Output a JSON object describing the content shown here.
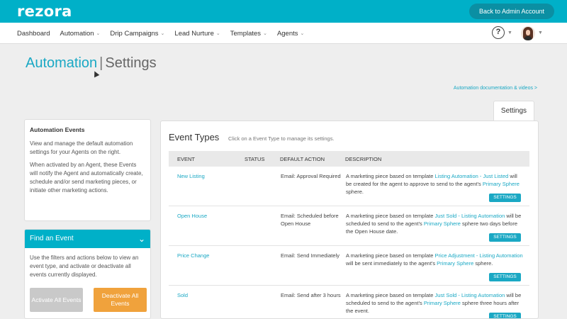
{
  "header": {
    "logo": "rezora",
    "back_button": "Back to Admin Account"
  },
  "nav": {
    "items": [
      {
        "label": "Dashboard",
        "dropdown": false
      },
      {
        "label": "Automation",
        "dropdown": true
      },
      {
        "label": "Drip Campaigns",
        "dropdown": true
      },
      {
        "label": "Lead Nurture",
        "dropdown": true
      },
      {
        "label": "Templates",
        "dropdown": true
      },
      {
        "label": "Agents",
        "dropdown": true
      }
    ],
    "help_icon": "?"
  },
  "page": {
    "title_main": "Automation",
    "title_sep": "|",
    "title_sub": "Settings",
    "doc_link": "Automation documentation & videos >",
    "tab_label": "Settings"
  },
  "info_card": {
    "title": "Automation Events",
    "p1": "View and manage the default automation settings for your Agents on the right.",
    "p2": "When activated by an Agent, these Events will notify the Agent and automatically create, schedule and/or send marketing pieces, or initiate other marketing actions."
  },
  "find_card": {
    "title": "Find an Event",
    "text": "Use the filters and actions below to view an event type, and activate or deactivate all events currently displayed.",
    "activate_label": "Activate All Events",
    "deactivate_label": "Deactivate All Events"
  },
  "main": {
    "title": "Event Types",
    "hint": "Click on a Event Type to manage its settings.",
    "columns": [
      "EVENT",
      "STATUS",
      "DEFAULT ACTION",
      "DESCRIPTION"
    ],
    "settings_label": "SETTINGS",
    "rows": [
      {
        "event": "New Listing",
        "action": "Email: Approval Required",
        "desc": [
          {
            "t": "A marketing piece based on template ",
            "hl": false
          },
          {
            "t": "Listing Automation - Just Listed",
            "hl": true
          },
          {
            "t": " will be created for the agent to approve to send to the agent's ",
            "hl": false
          },
          {
            "t": "Primary Sphere",
            "hl": true
          },
          {
            "t": " sphere.",
            "hl": false
          }
        ]
      },
      {
        "event": "Open House",
        "action": "Email: Scheduled before Open House",
        "desc": [
          {
            "t": "A marketing piece based on template ",
            "hl": false
          },
          {
            "t": "Just Sold - Listing Automation",
            "hl": true
          },
          {
            "t": " will be scheduled to send to the agent's ",
            "hl": false
          },
          {
            "t": "Primary Sphere",
            "hl": true
          },
          {
            "t": " sphere two days before the Open House date.",
            "hl": false
          }
        ]
      },
      {
        "event": "Price Change",
        "action": "Email: Send Immediately",
        "desc": [
          {
            "t": "A marketing piece based on template ",
            "hl": false
          },
          {
            "t": "Price Adjustment - Listing Automation",
            "hl": true
          },
          {
            "t": " will be sent immediately to the agent's ",
            "hl": false
          },
          {
            "t": "Primary Sphere",
            "hl": true
          },
          {
            "t": " sphere.",
            "hl": false
          }
        ]
      },
      {
        "event": "Sold",
        "action": "Email: Send after 3 hours",
        "desc": [
          {
            "t": "A marketing piece based on template ",
            "hl": false
          },
          {
            "t": "Just Sold - Listing Automation",
            "hl": true
          },
          {
            "t": " will be scheduled to send to the agent's ",
            "hl": false
          },
          {
            "t": "Primary Sphere",
            "hl": true
          },
          {
            "t": " sphere three hours after the event.",
            "hl": false
          }
        ]
      }
    ]
  },
  "colors": {
    "brand": "#00b0c8",
    "link": "#1aa8c4",
    "deactivate": "#f0a23c",
    "disabled": "#c9c9c9"
  }
}
